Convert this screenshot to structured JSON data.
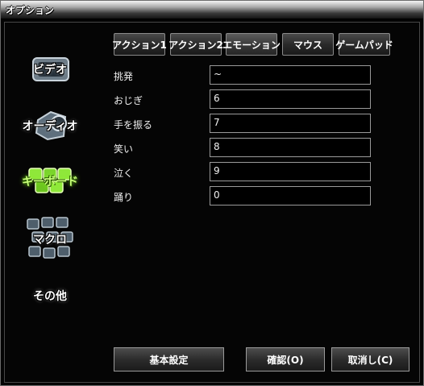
{
  "window": {
    "title": "オプション"
  },
  "tabs": [
    {
      "label": "アクション1"
    },
    {
      "label": "アクション2"
    },
    {
      "label": "エモーション"
    },
    {
      "label": "マウス"
    },
    {
      "label": "ゲームパッド"
    }
  ],
  "sidebar": [
    {
      "label": "ビデオ",
      "icon": "video-icon"
    },
    {
      "label": "オーディオ",
      "icon": "audio-icon"
    },
    {
      "label": "キーボード",
      "icon": "keyboard-icon",
      "selected": true
    },
    {
      "label": "マクロ",
      "icon": "macro-icon"
    },
    {
      "label": "その他",
      "icon": "other-icon"
    }
  ],
  "rows": [
    {
      "label": "挑発",
      "value": "~"
    },
    {
      "label": "おじぎ",
      "value": "6"
    },
    {
      "label": "手を振る",
      "value": "7"
    },
    {
      "label": "笑い",
      "value": "8"
    },
    {
      "label": "泣く",
      "value": "9"
    },
    {
      "label": "踊り",
      "value": "0"
    }
  ],
  "buttons": {
    "reset": "基本設定",
    "ok": "確認(O)",
    "cancel": "取消し(C)"
  }
}
